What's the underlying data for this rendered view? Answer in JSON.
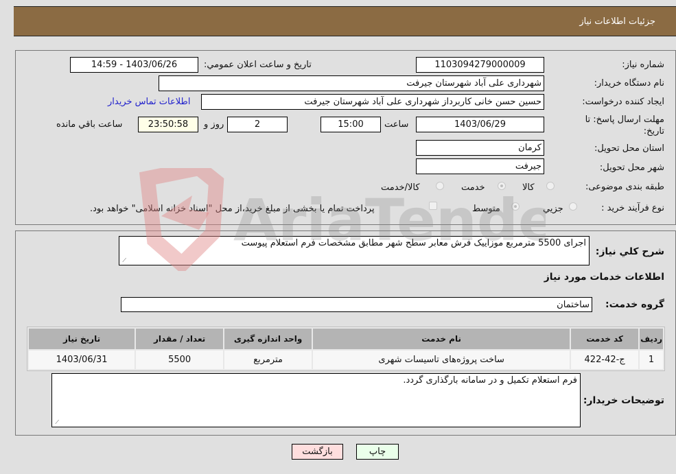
{
  "header": {
    "title": "جزئیات اطلاعات نیاز"
  },
  "form": {
    "need_number": {
      "label": "شماره نیاز:",
      "value": "1103094279000009"
    },
    "announce_datetime": {
      "label": "تاريخ و ساعت اعلان عمومي:",
      "value": "1403/06/26 - 14:59"
    },
    "buyer_org": {
      "label": "نام دستگاه خريدار:",
      "value": "شهرداری علی آباد شهرستان جیرفت"
    },
    "requester": {
      "label": "ايجاد کننده درخواست:",
      "value": "حسین حسن خانی کاربرداز شهرداری علی آباد شهرستان جیرفت"
    },
    "buyer_contact_link": "اطلاعات تماس خريدار",
    "deadline": {
      "label": "مهلت ارسال پاسخ: تا تاریخ:",
      "date": "1403/06/29",
      "time_label": "ساعت",
      "time": "15:00",
      "days": "2",
      "days_label": "روز و",
      "remaining": "23:50:58",
      "remaining_label": "ساعت باقي مانده"
    },
    "province": {
      "label": "استان محل تحويل:",
      "value": "کرمان"
    },
    "city": {
      "label": "شهر محل تحويل:",
      "value": "جیرفت"
    },
    "category": {
      "label": "طبقه بندی موضوعی:",
      "options": [
        "کالا",
        "خدمت",
        "کالا/خدمت"
      ],
      "selected": "خدمت"
    },
    "purchase_type": {
      "label": "نوع فرآيند خريد :",
      "options": [
        "جزيي",
        "متوسط"
      ],
      "selected": "متوسط",
      "treasury_note": "پرداخت تمام يا بخشی از مبلغ خريد،از محل \"اسناد خزانه اسلامی\" خواهد بود.",
      "treasury_checked": false
    }
  },
  "details": {
    "description_label": "شرح کلي نياز:",
    "description": "اجرای 5500 مترمربع موزاییک فرش معابر سطح شهر مطابق مشخصات فرم استعلام پیوست",
    "services_title": "اطلاعات خدمات مورد نياز",
    "service_group_label": "گروه خدمت:",
    "service_group": "ساختمان",
    "table": {
      "headers": [
        "رديف",
        "کد خدمت",
        "نام خدمت",
        "واحد اندازه گيری",
        "تعداد / مقدار",
        "تاريخ نياز"
      ],
      "rows": [
        [
          "1",
          "ج-42-422",
          "ساخت پروژه‌های تاسیسات شهری",
          "مترمربع",
          "5500",
          "1403/06/31"
        ]
      ]
    },
    "buyer_notes_label": "توضيحات خريدار:",
    "buyer_notes": "فرم استعلام تکمیل و در سامانه بارگذاری گردد."
  },
  "buttons": {
    "print": "چاپ",
    "back": "بازگشت"
  },
  "watermark": {
    "text": "AriaTender.neT"
  }
}
